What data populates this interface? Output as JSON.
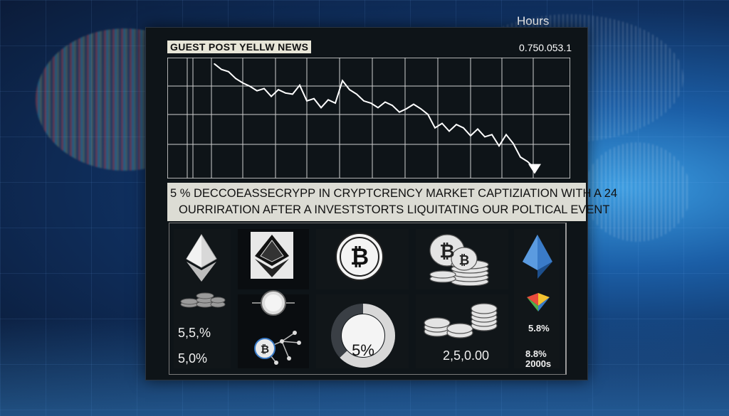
{
  "header": {
    "hours_label": "Hours",
    "chart_title": "GUEST POST YELLW NEWS",
    "chart_value": "0.750.053.1"
  },
  "chart_data": {
    "type": "line",
    "title": "GUEST POST YELLW NEWS",
    "x": [
      0,
      1,
      2,
      3,
      4,
      5,
      6,
      7,
      8,
      9,
      10,
      11,
      12,
      13,
      14,
      15,
      16,
      17,
      18,
      19,
      20,
      21,
      22,
      23,
      24,
      25,
      26,
      27,
      28,
      29,
      30,
      31,
      32,
      33,
      34,
      35,
      36,
      37,
      38,
      39,
      40,
      41,
      42,
      43,
      44,
      45
    ],
    "values": [
      97,
      92,
      90,
      84,
      80,
      77,
      73,
      75,
      68,
      74,
      71,
      70,
      78,
      64,
      66,
      58,
      65,
      62,
      82,
      74,
      70,
      64,
      62,
      58,
      63,
      60,
      54,
      57,
      61,
      57,
      52,
      40,
      44,
      37,
      43,
      40,
      33,
      39,
      32,
      34,
      24,
      34,
      26,
      14,
      10,
      4
    ],
    "ylim": [
      0,
      100
    ],
    "grid": true,
    "marker_end": "down-arrow",
    "line_color": "#ffffff"
  },
  "headline": {
    "line1": "5 % DECCOEASSECRYPP IN CRYPTCRENCY  MARKET CAPTIZIATION WITH A 24",
    "line2": "OURRIRATION  AFTER  A INVESTSTORTS LIQUITATING OUR POLTICAL  EVENT"
  },
  "tiles": {
    "stat_a": "5,5,%",
    "stat_b": "5,0%",
    "donut_label": "5%",
    "amount": "2,5,0.00",
    "stat_c": "5.8%",
    "stat_d": "8.8%",
    "stat_e": "2000s"
  },
  "icons": [
    "ethereum-icon",
    "ethereum-dark-icon",
    "bitcoin-icon",
    "coin-stack-bitcoin-icon",
    "ethereum-blue-icon",
    "coin-stack-icon",
    "toggle-icon",
    "network-node-icon",
    "donut-chart-icon",
    "coin-pile-icon",
    "colored-diamond-icon"
  ],
  "colors": {
    "panel_bg": "#0e1418",
    "headline_bg": "#dcdcd4",
    "accent_blue": "#3a7bc8"
  }
}
